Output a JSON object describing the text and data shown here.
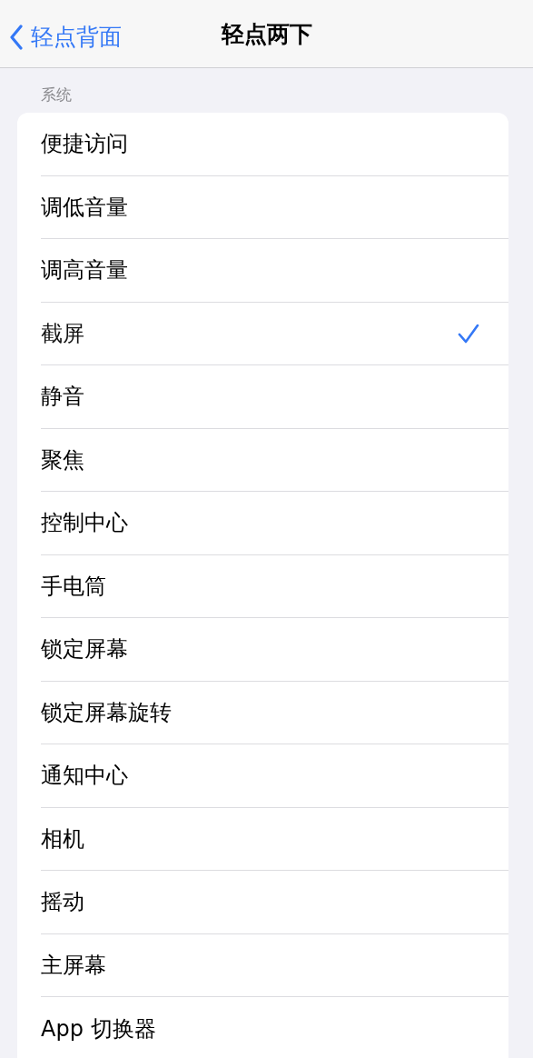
{
  "nav": {
    "back_label": "轻点背面",
    "title": "轻点两下"
  },
  "section": {
    "header": "系统",
    "items": [
      {
        "label": "便捷访问",
        "selected": false
      },
      {
        "label": "调低音量",
        "selected": false
      },
      {
        "label": "调高音量",
        "selected": false
      },
      {
        "label": "截屏",
        "selected": true
      },
      {
        "label": "静音",
        "selected": false
      },
      {
        "label": "聚焦",
        "selected": false
      },
      {
        "label": "控制中心",
        "selected": false
      },
      {
        "label": "手电筒",
        "selected": false
      },
      {
        "label": "锁定屏幕",
        "selected": false
      },
      {
        "label": "锁定屏幕旋转",
        "selected": false
      },
      {
        "label": "通知中心",
        "selected": false
      },
      {
        "label": "相机",
        "selected": false
      },
      {
        "label": "摇动",
        "selected": false
      },
      {
        "label": "主屏幕",
        "selected": false
      },
      {
        "label": "App 切换器",
        "selected": false
      }
    ]
  }
}
